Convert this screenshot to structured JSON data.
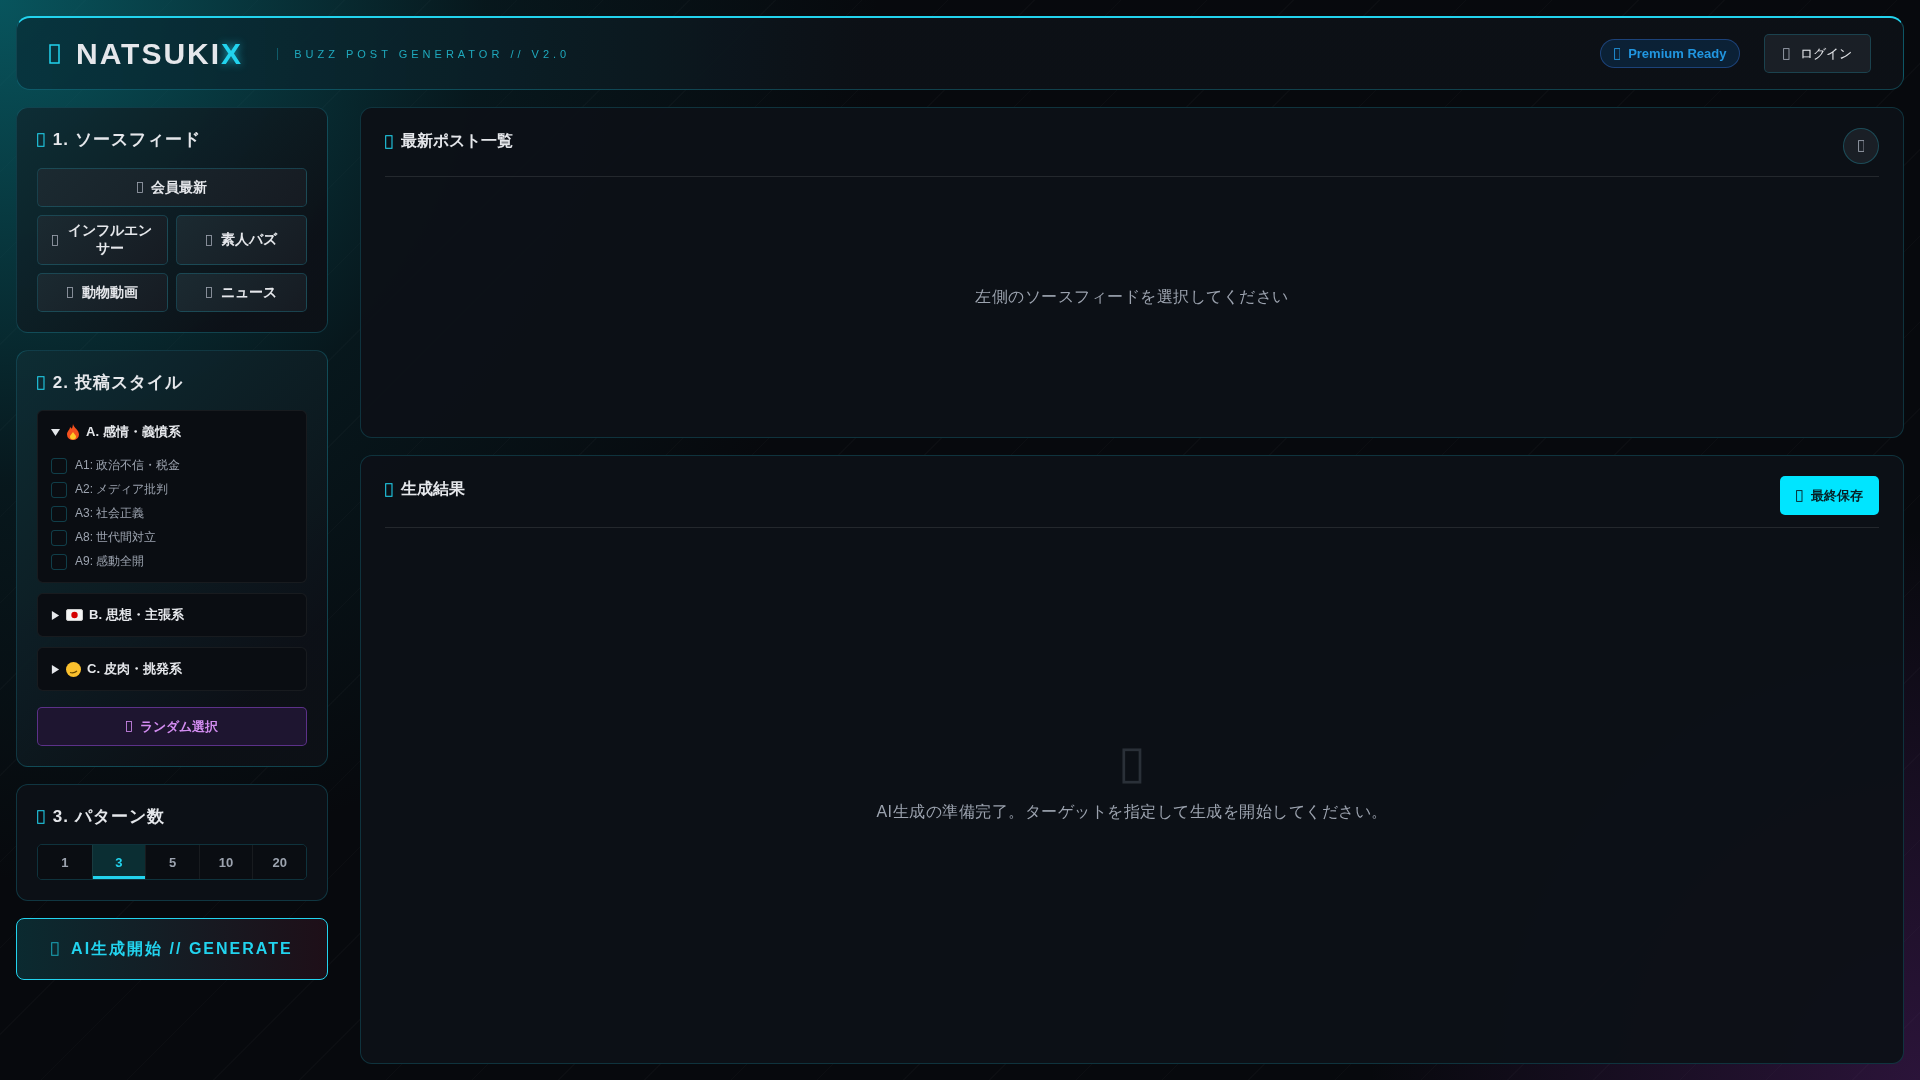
{
  "header": {
    "logo": "NATSUKI",
    "logo_accent": "X",
    "subtitle": "BUZZ POST GENERATOR // V2.0",
    "badge": "Premium Ready",
    "login": "ログイン"
  },
  "source_feed": {
    "title": "1. ソースフィード",
    "buttons": [
      {
        "label": "会員最新",
        "wide": true
      },
      {
        "label": "インフルエンサー",
        "wide": false
      },
      {
        "label": "素人バズ",
        "wide": false
      },
      {
        "label": "動物動画",
        "wide": false
      },
      {
        "label": "ニュース",
        "wide": false
      }
    ]
  },
  "post_style": {
    "title": "2. 投稿スタイル",
    "groups": [
      {
        "label": "A. 感情・義憤系",
        "kind": "fire",
        "expanded": true,
        "options": [
          {
            "label": "A1: 政治不信・税金",
            "checked": false
          },
          {
            "label": "A2: メディア批判",
            "checked": false
          },
          {
            "label": "A3: 社会正義",
            "checked": false
          },
          {
            "label": "A8: 世代間対立",
            "checked": false
          },
          {
            "label": "A9: 感動全開",
            "checked": false
          }
        ]
      },
      {
        "label": "B. 思想・主張系",
        "kind": "flag",
        "expanded": false
      },
      {
        "label": "C. 皮肉・挑発系",
        "kind": "smirk",
        "expanded": false
      }
    ],
    "random": "ランダム選択"
  },
  "patterns": {
    "title": "3. パターン数",
    "options": [
      {
        "label": "1",
        "selected": false
      },
      {
        "label": "3",
        "selected": true
      },
      {
        "label": "5",
        "selected": false
      },
      {
        "label": "10",
        "selected": false
      },
      {
        "label": "20",
        "selected": false
      }
    ]
  },
  "generate": "AI生成開始 // GENERATE",
  "posts": {
    "title": "最新ポスト一覧",
    "empty": "左側のソースフィードを選択してください"
  },
  "result": {
    "title": "生成結果",
    "save": "最終保存",
    "empty": "AI生成の準備完了。ターゲットを指定して生成を開始してください。"
  }
}
